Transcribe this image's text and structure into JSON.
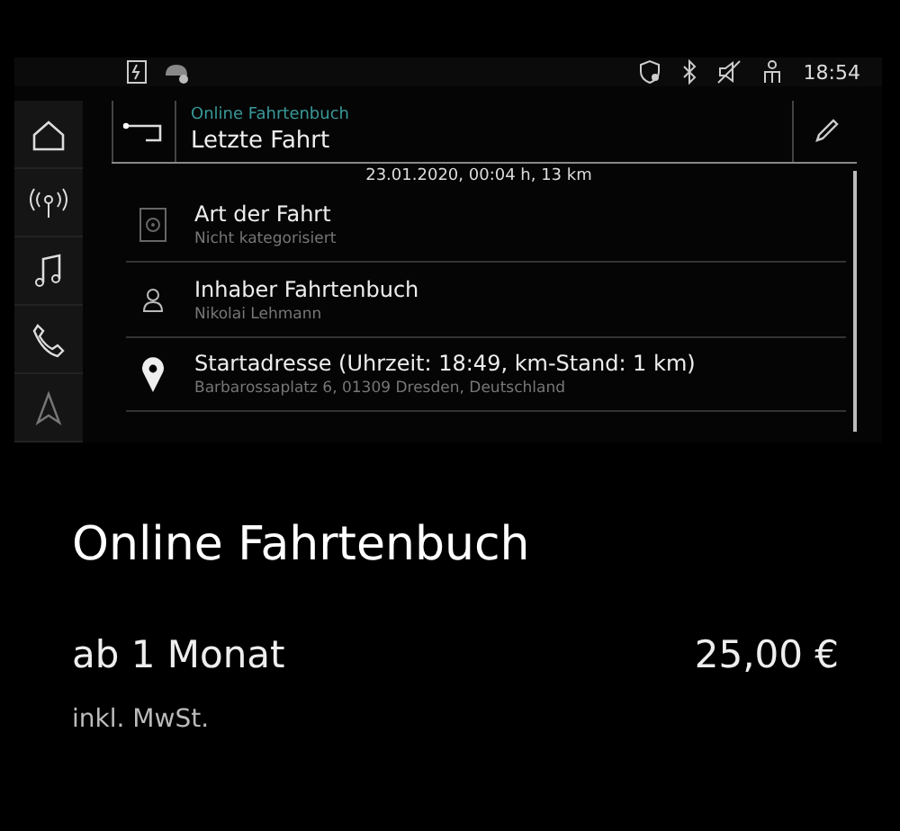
{
  "status_bar": {
    "time": "18:54"
  },
  "header": {
    "subtitle": "Online Fahrtenbuch",
    "title": "Letzte Fahrt"
  },
  "trip_summary": "23.01.2020, 00:04 h, 13 km",
  "rows": [
    {
      "title": "Art der Fahrt",
      "subtitle": "Nicht kategorisiert"
    },
    {
      "title": "Inhaber Fahrtenbuch",
      "subtitle": "Nikolai Lehmann"
    },
    {
      "title": "Startadresse (Uhrzeit: 18:49, km-Stand: 1 km)",
      "subtitle": "Barbarossaplatz 6, 01309 Dresden, Deutschland"
    }
  ],
  "offer": {
    "title": "Online Fahrtenbuch",
    "term": "ab 1 Monat",
    "price": "25,00 €",
    "tax_note": "inkl. MwSt."
  }
}
